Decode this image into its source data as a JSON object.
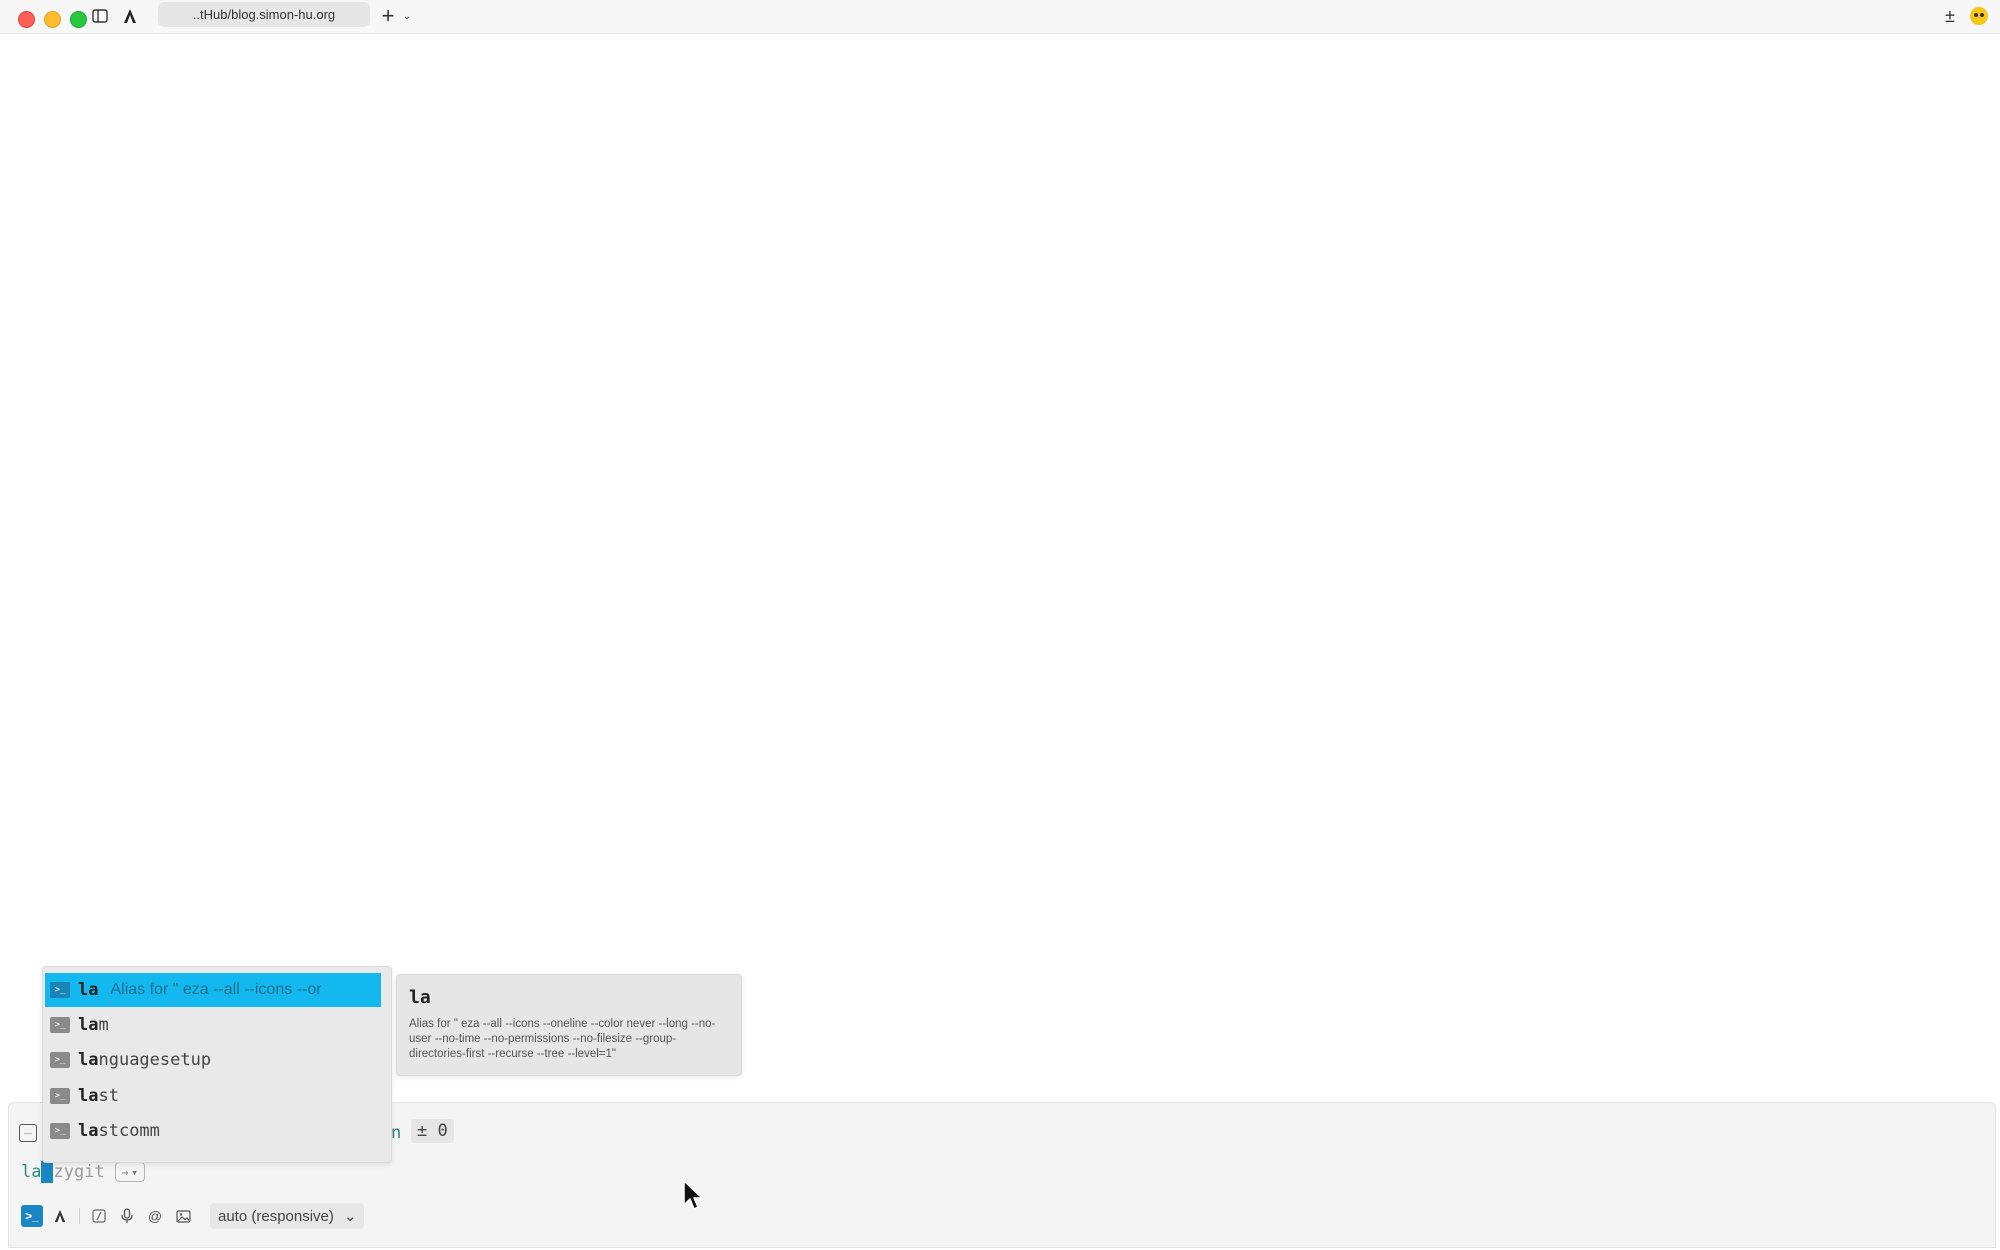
{
  "window": {
    "tab_title": "..tHub/blog.simon-hu.org",
    "new_tab_icon": "plus-icon",
    "sync_icon": "plus-minus-icon",
    "avatar_icon": "emoji-avatar"
  },
  "prompt": {
    "git_branch_fragment": "n",
    "diff_count": "± 0",
    "typed": "la",
    "ghost_completion": "zygit",
    "accept_hint": "→"
  },
  "toolbar": {
    "model": "auto (responsive)"
  },
  "completions": {
    "items": [
      {
        "match": "la",
        "rest": "",
        "description": "Alias for \"     eza --all --icons --or",
        "selected": true
      },
      {
        "match": "la",
        "rest": "m",
        "description": "",
        "selected": false
      },
      {
        "match": "la",
        "rest": "nguagesetup",
        "description": "",
        "selected": false
      },
      {
        "match": "la",
        "rest": "st",
        "description": "",
        "selected": false
      },
      {
        "match": "la",
        "rest": "stcomm",
        "description": "",
        "selected": false
      }
    ],
    "detail": {
      "title": "la",
      "body": "Alias for \"     eza --all --icons --oneline --color never --long --no-user --no-time --no-permissions --no-filesize --group-directories-first --recurse --tree --level=1\""
    }
  },
  "colors": {
    "accent": "#12b8ee",
    "terminal_mode": "#1b86c4"
  }
}
